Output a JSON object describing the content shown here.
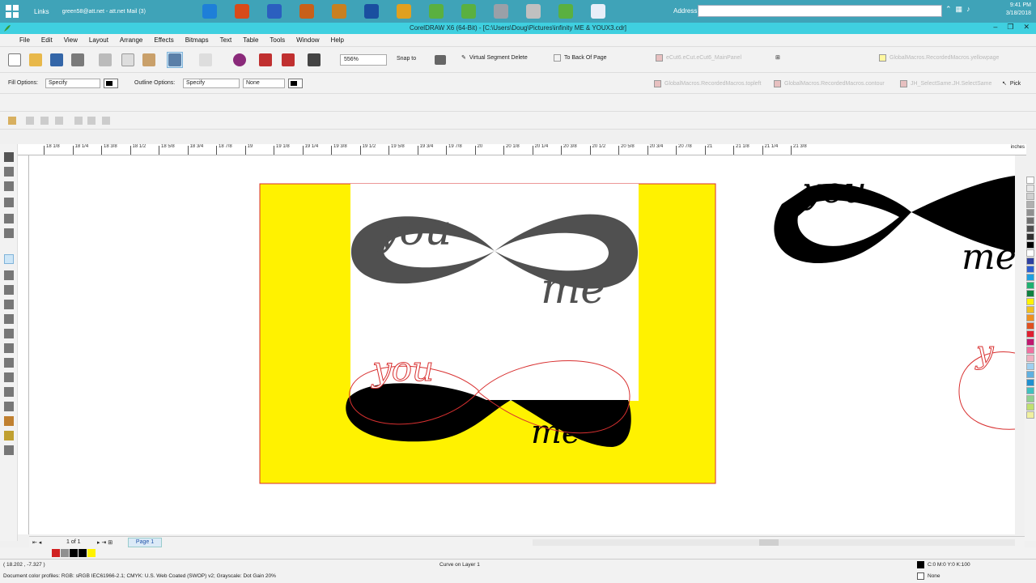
{
  "taskbar": {
    "links_label": "Links",
    "mail_task": "green58@att.net - att.net Mail (3)",
    "address_label": "Address",
    "address_value": "",
    "time": "9:41 PM",
    "date": "3/18/2018",
    "icons": [
      "ie-icon",
      "calendar-icon",
      "word-icon",
      "paint-icon",
      "pen-icon",
      "s-app-icon",
      "chrome-icon",
      "corel-leaf-icon",
      "corel-leaf-icon",
      "printer-icon",
      "gear-icon",
      "corel-leaf-icon",
      "document-icon"
    ]
  },
  "window": {
    "title": "CorelDRAW X6 (64-Bit) - [C:\\Users\\Doug\\Pictures\\infinity ME & YOUX3.cdr]"
  },
  "menu": {
    "items": [
      "File",
      "Edit",
      "View",
      "Layout",
      "Arrange",
      "Effects",
      "Bitmaps",
      "Text",
      "Table",
      "Tools",
      "Window",
      "Help"
    ]
  },
  "toolbar": {
    "zoom": "556%",
    "snap_to": "Snap to",
    "virtual_segment_delete": "Virtual Segment Delete",
    "to_back_of_page": "To Back Of Page",
    "macro_mainpanel": "eCut6.eCut.eCut6_MainPanel",
    "macro_yellowpage": "GlobalMacros.RecordedMacros.yellowpage"
  },
  "propertybar": {
    "fill_options_label": "Fill Options:",
    "fill_options_value": "Specify",
    "outline_options_label": "Outline Options:",
    "outline_options_value": "Specify",
    "outline_width": "None",
    "macro_topleft": "GlobalMacros.RecordedMacros.topleft",
    "macro_contour": "GlobalMacros.RecordedMacros.contour",
    "macro_selectsame": "JH_SelectSame.JH.SelectSame",
    "pick_label": "Pick"
  },
  "ruler": {
    "ticks": [
      "18 1/8",
      "18 1/4",
      "18 3/8",
      "18 1/2",
      "18 5/8",
      "18 3/4",
      "18 7/8",
      "19",
      "19 1/8",
      "19 1/4",
      "19 3/8",
      "19 1/2",
      "19 5/8",
      "19 3/4",
      "19 7/8",
      "20",
      "20 1/8",
      "20 1/4",
      "20 3/8",
      "20 1/2",
      "20 5/8",
      "20 3/4",
      "20 7/8",
      "21",
      "21 1/8",
      "21 1/4",
      "21 3/8"
    ],
    "units": "inches"
  },
  "canvas": {
    "top_word_you": "you",
    "top_word_me": "me",
    "bottom_word_you": "you",
    "bottom_word_me": "me",
    "right_word_you": "you",
    "right_word_me": "me",
    "right_outline_y": "y",
    "colors": {
      "yellow": "#fff200",
      "graphic_gray": "#505050",
      "graphic_black": "#000000",
      "outline_red": "#d83030"
    }
  },
  "pagebar": {
    "page_of": "1 of 1",
    "page_tab": "Page 1"
  },
  "status": {
    "coords": "( 18.202 , -7.327 )",
    "selection": "Curve on Layer 1",
    "color_profile": "Document color profiles: RGB: sRGB IEC61966-2.1; CMYK: U.S. Web Coated (SWOP) v2; Grayscale: Dot Gain 20%",
    "fill_info": "C:0 M:0 Y:0 K:100",
    "outline_info": "None"
  },
  "palette": {
    "colors": [
      "#ffffff",
      "#e8e8e8",
      "#d0d0d0",
      "#b0b0b0",
      "#909090",
      "#707070",
      "#505050",
      "#303030",
      "#000000",
      "#ffffff",
      "#3040a0",
      "#3060d0",
      "#20a0e0",
      "#20b070",
      "#108040",
      "#fff200",
      "#f0c020",
      "#f09020",
      "#e05020",
      "#e02030",
      "#c01870",
      "#f070a0",
      "#f0b0c0",
      "#a0d0f0",
      "#60b0e0",
      "#2090d0",
      "#40c0c0",
      "#90d090",
      "#c0e070",
      "#f0f0a0"
    ],
    "doc_colors": [
      "#d02020",
      "#909090",
      "#000000",
      "#000000",
      "#fff200"
    ]
  }
}
